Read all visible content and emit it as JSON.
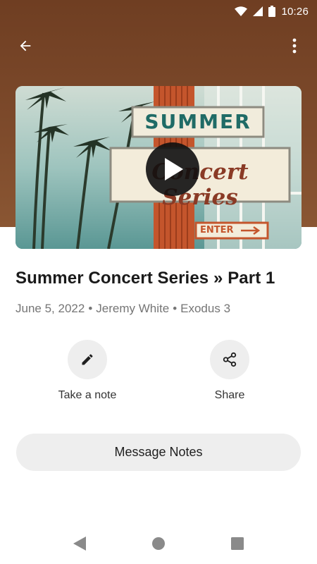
{
  "status_bar": {
    "time": "10:26"
  },
  "app_bar": {
    "back_icon": "arrow-left-icon",
    "menu_icon": "more-vert-icon"
  },
  "thumbnail": {
    "sign_top": "SUMMER",
    "sign_main": "Concert Series",
    "sign_enter": "ENTER",
    "play_icon": "play-icon"
  },
  "sermon": {
    "title": "Summer Concert Series » Part 1",
    "date": "June 5, 2022",
    "speaker": "Jeremy White",
    "passage": "Exodus 3",
    "separator": "•"
  },
  "actions": [
    {
      "label": "Take a note",
      "icon": "pencil-icon"
    },
    {
      "label": "Share",
      "icon": "share-icon"
    }
  ],
  "message_notes_button": {
    "label": "Message Notes"
  },
  "colors": {
    "header_bg": "#7d4a2b",
    "accent_orange": "#c4552c",
    "sign_teal": "#1f6b66",
    "button_bg": "#eeeeee"
  }
}
